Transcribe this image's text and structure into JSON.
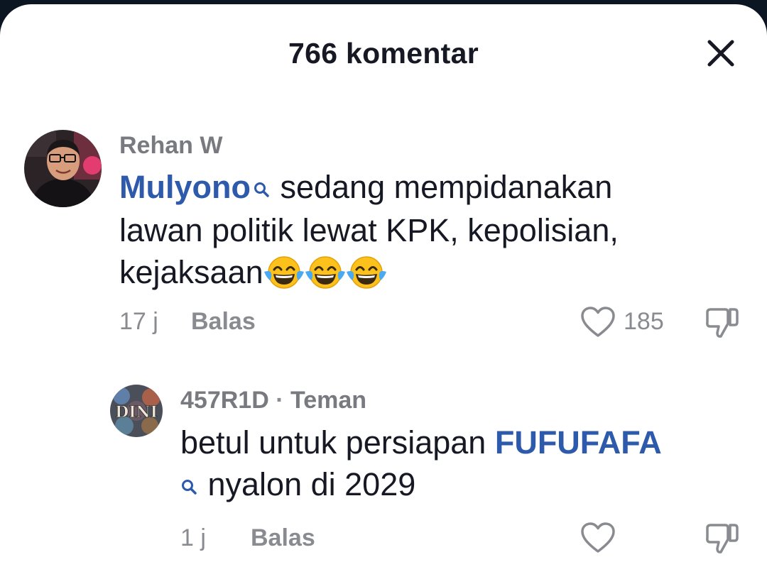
{
  "header": {
    "title": "766 komentar"
  },
  "comments": [
    {
      "author": "Rehan W",
      "mention": "Mulyono",
      "text_line1": " sedang mempidanakan",
      "text_line2": "lawan politik lewat KPK, kepolisian,",
      "text_line3": "kejaksaan",
      "emojis": [
        "😂",
        "😂",
        "😂"
      ],
      "time": "17 j",
      "reply_label": "Balas",
      "likes": "185"
    },
    {
      "author": "457R1D",
      "author_tag": "Teman",
      "author_separator": " · ",
      "avatar_text": "DINI",
      "text_line1": "betul untuk persiapan ",
      "mention": "FUFUFAFA",
      "text_line2": " nyalon di 2029",
      "time": "1 j",
      "reply_label": "Balas"
    }
  ],
  "colors": {
    "mention": "#2e5aac",
    "text": "#161823",
    "muted": "#8a8b91",
    "background_top": "#0c1522"
  },
  "icons": [
    "close-icon",
    "search-icon",
    "heart-icon",
    "thumbs-down-icon",
    "face-with-tears-of-joy-emoji"
  ]
}
